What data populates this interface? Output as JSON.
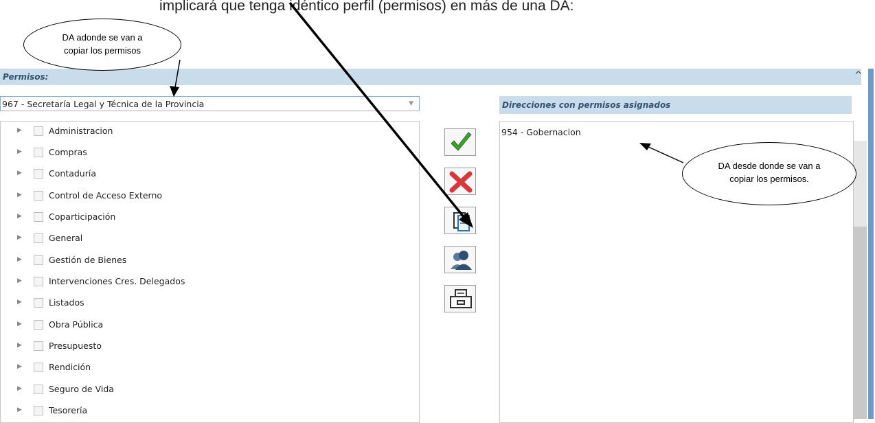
{
  "doc_line": "implicará que tenga idéntico perfil (permisos) en más de una DA:",
  "panel": {
    "title": "Permisos:"
  },
  "combo": {
    "value": "967 - Secretaría Legal y Técnica de la Provincia"
  },
  "tree_items": [
    "Administracion",
    "Compras",
    "Contaduría",
    "Control de Acceso Externo",
    "Coparticipación",
    "General",
    "Gestión de Bienes",
    "Intervenciones Cres. Delegados",
    "Listados",
    "Obra Pública",
    "Presupuesto",
    "Rendición",
    "Seguro de Vida",
    "Tesorería"
  ],
  "buttons": [
    "confirm-icon",
    "delete-icon",
    "copy-permissions-icon",
    "users-icon",
    "print-icon"
  ],
  "right_panel": {
    "title": "Direcciones con permisos asignados",
    "items": [
      "954 - Gobernacion"
    ]
  },
  "callout_left": {
    "line1": "DA adonde se van a",
    "line2": "copiar los permisos"
  },
  "callout_right": {
    "line1": "DA desde donde se van a",
    "line2": "copiar los permisos."
  },
  "colors": {
    "header_bg": "#c9dceb",
    "check_green": "#3aa02e",
    "delete_red": "#d9383b",
    "accent_blue": "#6f9bc8"
  }
}
